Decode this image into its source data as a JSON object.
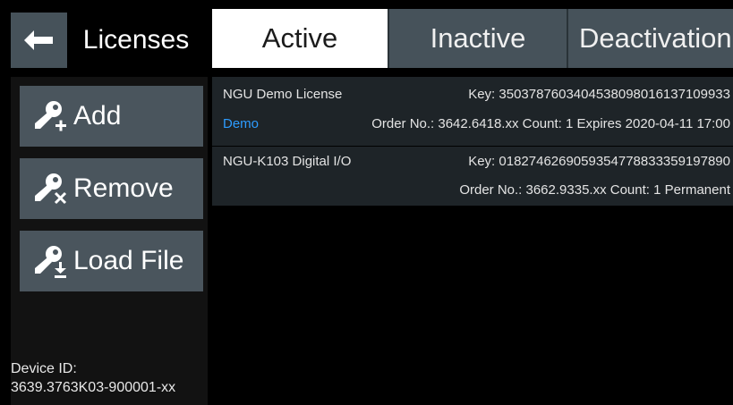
{
  "header": {
    "title": "Licenses",
    "back_icon": "arrow-left-icon"
  },
  "sidebar": {
    "buttons": [
      {
        "label": "Add",
        "icon": "key-add-icon"
      },
      {
        "label": "Remove",
        "icon": "key-remove-icon"
      },
      {
        "label": "Load File",
        "icon": "key-load-icon"
      }
    ],
    "device_id_label": "Device ID:",
    "device_id_value": "3639.3763K03-900001-xx"
  },
  "tabs": [
    {
      "label": "Active",
      "selected": true
    },
    {
      "label": "Inactive",
      "selected": false
    },
    {
      "label": "Deactivation",
      "selected": false
    }
  ],
  "licenses": [
    {
      "name": "NGU Demo License",
      "key": "Key: 3503787603404538098016137109933",
      "tag": "Demo",
      "details": "Order No.: 3642.6418.xx  Count: 1  Expires 2020-04-11 17:00"
    },
    {
      "name": "NGU-K103 Digital I/O",
      "key": "Key: 0182746269059354778833359197890",
      "tag": "",
      "details": "Order No.: 3662.9335.xx  Count: 1  Permanent"
    }
  ],
  "colors": {
    "button_bg": "#4a555d",
    "tab_active_bg": "#ffffff",
    "tab_inactive_bg": "#46525a",
    "row_bg": "#1e2428",
    "demo_tag": "#2d9cff"
  }
}
